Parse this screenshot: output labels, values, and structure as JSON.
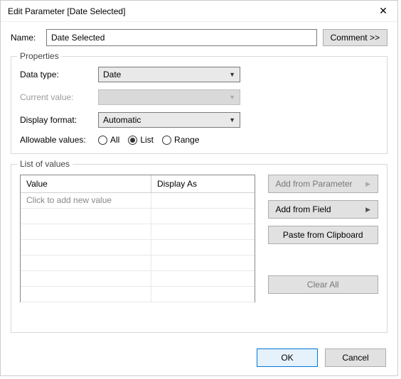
{
  "window": {
    "title": "Edit Parameter [Date Selected]"
  },
  "name": {
    "label": "Name:",
    "value": "Date Selected"
  },
  "comment_button": "Comment >>",
  "properties": {
    "legend": "Properties",
    "data_type": {
      "label": "Data type:",
      "value": "Date"
    },
    "current_value": {
      "label": "Current value:",
      "value": ""
    },
    "display_format": {
      "label": "Display format:",
      "value": "Automatic"
    },
    "allowable": {
      "label": "Allowable values:",
      "options": {
        "all": "All",
        "list": "List",
        "range": "Range"
      },
      "selected": "list"
    }
  },
  "list_of_values": {
    "legend": "List of values",
    "headers": {
      "value": "Value",
      "display_as": "Display As"
    },
    "placeholder": "Click to add new value",
    "buttons": {
      "add_from_parameter": "Add from Parameter",
      "add_from_field": "Add from Field",
      "paste_clipboard": "Paste from Clipboard",
      "clear_all": "Clear All"
    }
  },
  "footer": {
    "ok": "OK",
    "cancel": "Cancel"
  }
}
